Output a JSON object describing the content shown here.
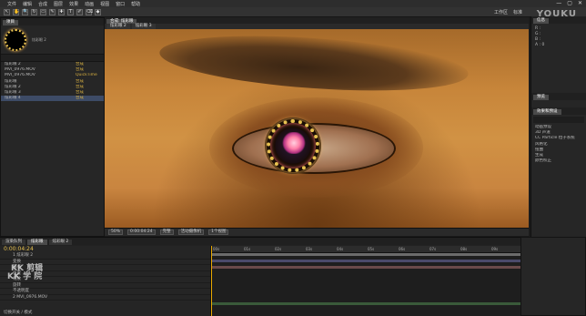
{
  "menubar": {
    "items": [
      "文件",
      "编辑",
      "合成",
      "图层",
      "效果",
      "动画",
      "视图",
      "窗口",
      "帮助"
    ]
  },
  "toolbar": {
    "tools": [
      "↖",
      "✋",
      "🔍",
      "↻",
      "▭",
      "✎",
      "✚",
      "T",
      "✐",
      "⌫",
      "◆"
    ]
  },
  "window": {
    "min": "—",
    "max": "▢",
    "close": "✕",
    "workspace_label": "工作区",
    "workspace_value": "标准"
  },
  "watermark": "YOUKU",
  "overlay": {
    "line1": "KK 剪辑",
    "line2": "KK 学 院"
  },
  "project": {
    "tab": "项目",
    "items": [
      {
        "name": "炫彩眼 2",
        "sel": false
      },
      {
        "name": "MVI_0976.MOV",
        "sel": false
      },
      {
        "name": "MVI_0976.MOV",
        "sel": false
      },
      {
        "name": "炫彩眼",
        "sel": false
      },
      {
        "name": "炫彩眼 2",
        "sel": false
      },
      {
        "name": "炫彩眼 3",
        "sel": false
      },
      {
        "name": "炫彩眼 4",
        "sel": true
      }
    ],
    "types": [
      "合成",
      "合成",
      "QuickTime",
      "合成",
      "合成",
      "合成",
      "合成"
    ]
  },
  "composition": {
    "tabs": [
      "合成: 炫彩眼",
      "炫彩眼 2",
      "炫彩眼 3"
    ],
    "zoom": "50%",
    "resolution": "完整",
    "camera": "活动摄像机",
    "views": "1个视图",
    "timecode": "0:00:04:24"
  },
  "right_panel": {
    "info_tab": "信息",
    "values": [
      "R :",
      "G :",
      "B :",
      "A : 0"
    ],
    "preview_tab": "预览",
    "effects_tab": "效果和预设",
    "effects_items": [
      "动画预设",
      "3D 声道",
      "CC Particle 粒子系统",
      "风格化",
      "扭曲",
      "生成",
      "颜色校正"
    ]
  },
  "timeline": {
    "tabs": [
      "渲染队列",
      "炫彩眼",
      "炫彩眼 2"
    ],
    "timecode": "0:00:04:24",
    "layers": [
      "1  炫彩眼 2",
      "    变换",
      "    锚点",
      "    位置",
      "    缩放",
      "    旋转",
      "    不透明度",
      "2  MVI_0976.MOV"
    ],
    "ruler_labels": [
      "00s",
      "01s",
      "02s",
      "03s",
      "04s",
      "05s",
      "06s",
      "07s",
      "08s",
      "09s"
    ],
    "footer": "切换开关 / 模式"
  }
}
